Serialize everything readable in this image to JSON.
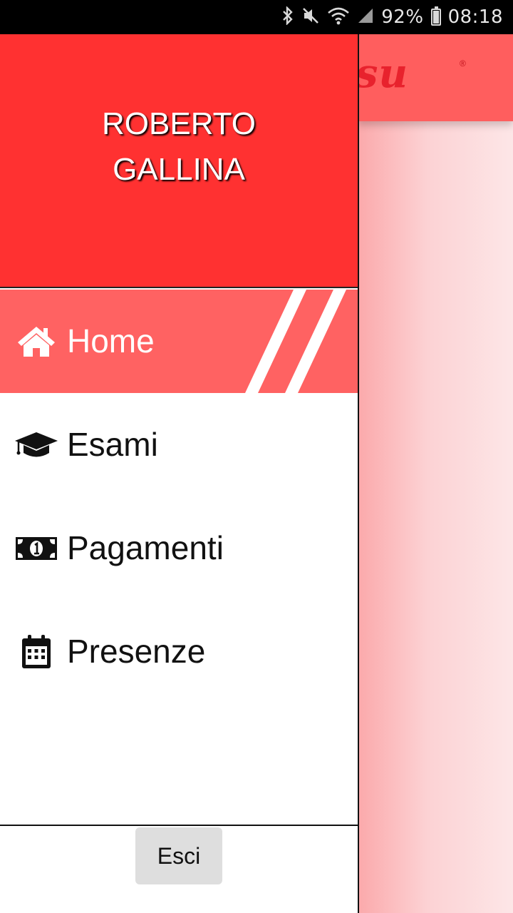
{
  "status_bar": {
    "icons": [
      "bluetooth-icon",
      "mute-icon",
      "wifi-icon",
      "signal-icon",
      "battery-icon"
    ],
    "battery_percent": "92%",
    "battery_level": 0.92,
    "time": "08:18"
  },
  "background_app": {
    "logo_text": "tsu",
    "logo_trademark": "®",
    "toolbar_color": "#ff5e5e"
  },
  "drawer": {
    "header_color": "#ff3131",
    "user": {
      "first_name": "ROBERTO",
      "last_name": "GALLINA"
    },
    "items": [
      {
        "label": "Home",
        "icon": "home-icon",
        "active": true
      },
      {
        "label": "Esami",
        "icon": "graduation-cap-icon",
        "active": false
      },
      {
        "label": "Pagamenti",
        "icon": "money-bill-icon",
        "active": false
      },
      {
        "label": "Presenze",
        "icon": "calendar-icon",
        "active": false
      }
    ],
    "active_color": "#ff6262",
    "logout_label": "Esci"
  }
}
